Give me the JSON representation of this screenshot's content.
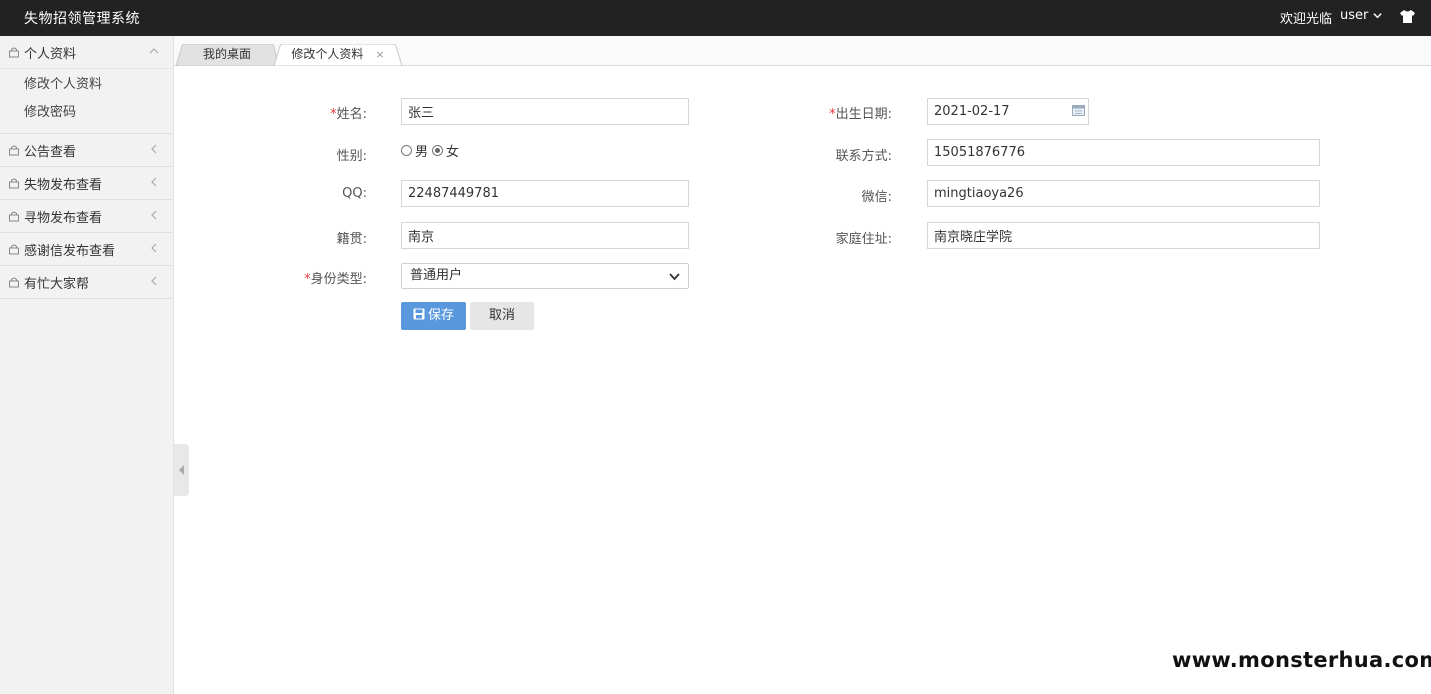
{
  "app": {
    "title": "失物招领管理系统"
  },
  "header": {
    "welcome": "欢迎光临",
    "user": "user",
    "skin_icon": "tshirt-icon"
  },
  "sidebar": {
    "groups": [
      {
        "label": "个人资料",
        "expanded": true,
        "items": [
          "修改个人资料",
          "修改密码"
        ]
      },
      {
        "label": "公告查看"
      },
      {
        "label": "失物发布查看"
      },
      {
        "label": "寻物发布查看"
      },
      {
        "label": "感谢信发布查看"
      },
      {
        "label": "有忙大家帮"
      }
    ]
  },
  "tabs": [
    {
      "label": "我的桌面"
    },
    {
      "label": "修改个人资料",
      "close": "×"
    }
  ],
  "form": {
    "required_mark": "*",
    "name": {
      "label": "姓名:",
      "value": "张三"
    },
    "birthday": {
      "label": "出生日期:",
      "value": "2021-02-17"
    },
    "gender": {
      "label": "性别:",
      "options": [
        "男",
        "女"
      ],
      "selected": "女"
    },
    "phone": {
      "label": "联系方式:",
      "value": "15051876776"
    },
    "qq": {
      "label": "QQ:",
      "value": "22487449781"
    },
    "wechat": {
      "label": "微信:",
      "value": "mingtiaoya26"
    },
    "hometown": {
      "label": "籍贯:",
      "value": "南京"
    },
    "address": {
      "label": "家庭住址:",
      "value": "南京晓庄学院"
    },
    "identity": {
      "label": "身份类型:",
      "value": "普通用户"
    },
    "save_label": "保存",
    "cancel_label": "取消"
  },
  "watermark": "www.monsterhua.com",
  "colors": {
    "topbar": "#222222",
    "primary": "#5a98de",
    "required": "#e4393c",
    "sidebar_bg": "#f2f2f2"
  }
}
